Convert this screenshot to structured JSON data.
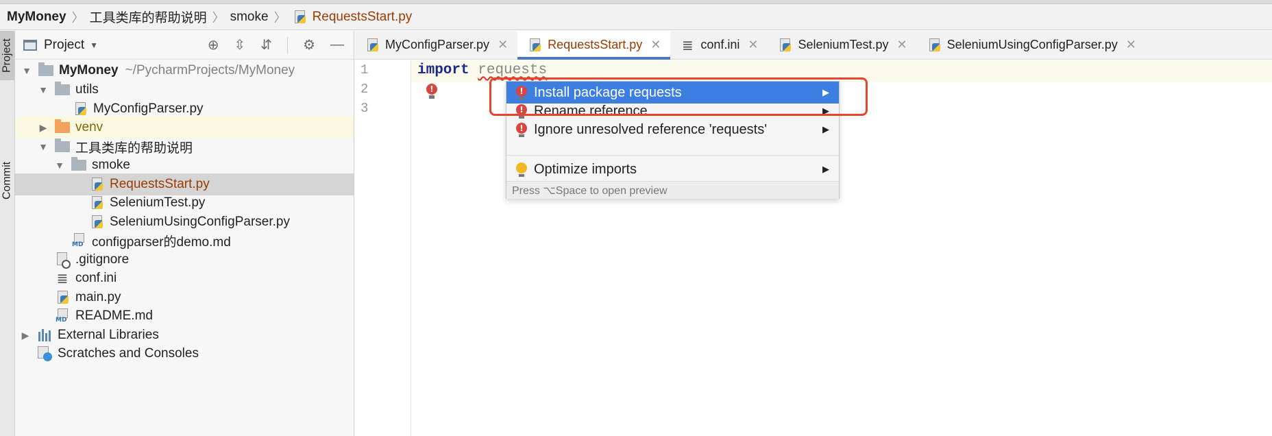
{
  "breadcrumb": {
    "items": [
      "MyMoney",
      "工具类库的帮助说明",
      "smoke",
      "RequestsStart.py"
    ]
  },
  "tool_strip": {
    "project_label": "Project",
    "commit_label": "Commit"
  },
  "project_panel": {
    "title": "Project",
    "tree": [
      {
        "label": "MyMoney",
        "path": "~/PycharmProjects/MyMoney"
      },
      {
        "label": "utils"
      },
      {
        "label": "MyConfigParser.py"
      },
      {
        "label": "venv"
      },
      {
        "label": "工具类库的帮助说明"
      },
      {
        "label": "smoke"
      },
      {
        "label": "RequestsStart.py"
      },
      {
        "label": "SeleniumTest.py"
      },
      {
        "label": "SeleniumUsingConfigParser.py"
      },
      {
        "label": "configparser的demo.md"
      },
      {
        "label": ".gitignore"
      },
      {
        "label": "conf.ini"
      },
      {
        "label": "main.py"
      },
      {
        "label": "README.md"
      },
      {
        "label": "External Libraries"
      },
      {
        "label": "Scratches and Consoles"
      }
    ]
  },
  "tabs": [
    {
      "label": "MyConfigParser.py"
    },
    {
      "label": "RequestsStart.py"
    },
    {
      "label": "conf.ini"
    },
    {
      "label": "SeleniumTest.py"
    },
    {
      "label": "SeleniumUsingConfigParser.py"
    }
  ],
  "editor": {
    "line_numbers": [
      "1",
      "2",
      "3"
    ],
    "code_keyword": "import",
    "code_module": "requests"
  },
  "popup": {
    "items": [
      {
        "label": "Install package requests"
      },
      {
        "label": "Rename reference"
      },
      {
        "label": "Ignore unresolved reference 'requests'"
      },
      {
        "label": "Optimize imports"
      }
    ],
    "footer": "Press ⌥Space to open preview"
  },
  "colors": {
    "accent": "#3d7fe0",
    "highlight": "#e8452f",
    "selected_file": "#9c3b00"
  }
}
